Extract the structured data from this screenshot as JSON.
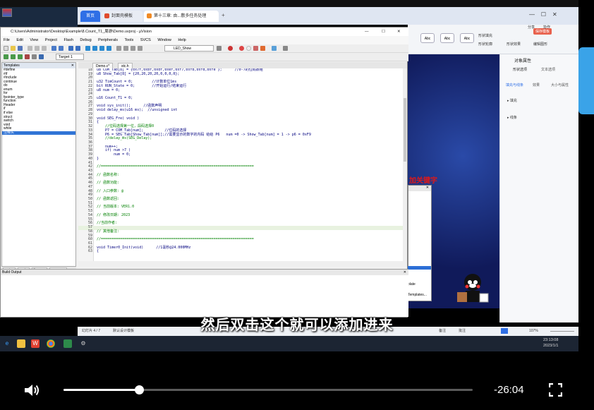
{
  "browser": {
    "tabs": [
      {
        "label": "首页"
      },
      {
        "label": "封面壳模板"
      },
      {
        "label": "第十三章: 由...敷多任务处理"
      }
    ]
  },
  "uvision": {
    "title": "C:\\Users\\Administrator\\Desktop\\Example\\8.Count_T1_周游\\Demo.uvproj - µVision",
    "menu": [
      "File",
      "Edit",
      "View",
      "Project",
      "Flash",
      "Debug",
      "Peripherals",
      "Tools",
      "SVCS",
      "Window",
      "Help"
    ],
    "toolbar_target": "LED_Show",
    "target_label": "Target 1",
    "templates_title": "Templates",
    "templates": [
      "#define",
      "#if",
      "#include",
      "continue",
      "do",
      "enum",
      "for",
      "fpointer_type",
      "function",
      "Header",
      "if",
      "if else",
      "struct",
      "switch",
      "void",
      "while",
      "注释头"
    ],
    "templates_selected": "注释头",
    "panel_tabs": [
      "Project",
      "Books",
      "{} Func...",
      "0+ Temp..."
    ],
    "editor_tabs": [
      "Demo.c*",
      "stc.h"
    ],
    "build_output_title": "Build Output",
    "code": [
      {
        "n": "18",
        "t": "u8 COM_Tab[8] = {0x7f,0xbf,0xdf,0xef,0xf7,0xfb,0xfd,0xfe };      //0-7的位码数组"
      },
      {
        "n": "19",
        "t": "u8 Show_Tab[8] = {20,20,20,20,0,0,0,0};"
      },
      {
        "n": "20",
        "t": ""
      },
      {
        "n": "21",
        "t": "u32 TimCount = 0;         //计数单位1ms"
      },
      {
        "n": "22",
        "t": "bit RUN_State = 0;        //开始运行/结束运行"
      },
      {
        "n": "23",
        "t": "u8 num = 0;"
      },
      {
        "n": "24",
        "t": ""
      },
      {
        "n": "25",
        "t": "u16 Count_T1 = 0;"
      },
      {
        "n": "26",
        "t": ""
      },
      {
        "n": "27",
        "t": "void sys_init();      //函数声明"
      },
      {
        "n": "28",
        "t": "void delay_ms(u16 ms);  //unsigned int"
      },
      {
        "n": "29",
        "t": ""
      },
      {
        "n": "30",
        "t": "void SEG_Fre( void )"
      },
      {
        "n": "31",
        "t": "{"
      },
      {
        "n": "32",
        "t": "    //位码选择第一位，段码选择0"
      },
      {
        "n": "33",
        "t": "    P7 = COM_Tab[num];          //位码的选择"
      },
      {
        "n": "34",
        "t": "    P6 = SEG_Tab[Show_Tab[num]];//需要显示的数字的内码 给给 P6   num =0 -> Show_Tab[num] = 1 -> p6 = 0xF9"
      },
      {
        "n": "35",
        "t": "    //delay_ms(SEG_Delay);"
      },
      {
        "n": "36",
        "t": ""
      },
      {
        "n": "37",
        "t": "    num++;"
      },
      {
        "n": "38",
        "t": "    if( num >7 )"
      },
      {
        "n": "39",
        "t": "        num = 0;"
      },
      {
        "n": "40",
        "t": "}"
      },
      {
        "n": "41",
        "t": ""
      },
      {
        "n": "42",
        "t": "//========================================================================"
      },
      {
        "n": "43",
        "t": ""
      },
      {
        "n": "44",
        "t": "// 函数名称:"
      },
      {
        "n": "45",
        "t": ""
      },
      {
        "n": "46",
        "t": "// 函数功能:"
      },
      {
        "n": "47",
        "t": ""
      },
      {
        "n": "48",
        "t": "// 入口参数: @"
      },
      {
        "n": "49",
        "t": ""
      },
      {
        "n": "50",
        "t": "// 函数返回:"
      },
      {
        "n": "51",
        "t": ""
      },
      {
        "n": "52",
        "t": "// 当前版本: VER1.0"
      },
      {
        "n": "53",
        "t": ""
      },
      {
        "n": "54",
        "t": "// 修改日期: 2023"
      },
      {
        "n": "55",
        "t": ""
      },
      {
        "n": "56",
        "t": "//当前作者:"
      },
      {
        "n": "57",
        "t": ""
      },
      {
        "n": "58",
        "t": "// 其他备注:"
      },
      {
        "n": "59",
        "t": ""
      },
      {
        "n": "60",
        "t": "//========================================================================"
      },
      {
        "n": "61",
        "t": ""
      },
      {
        "n": "62",
        "t": "void Timer0_Init(void)      //1毫秒@24.000MHz"
      },
      {
        "n": "63",
        "t": "{"
      }
    ]
  },
  "ppt": {
    "toolbar_items": [
      "形状填充",
      "形状轮廓",
      "形状效果",
      "编辑图形",
      "设计",
      "保存模板",
      "创意"
    ],
    "panel_title": "对象属性",
    "panel_tabs": [
      "形状选项",
      "文本选项"
    ],
    "panel_subtabs": [
      "填充与线条",
      "效果",
      "大小与属性"
    ],
    "panel_rows": [
      "填充",
      "线条"
    ],
    "share": "分享",
    "collab": "协作",
    "keyword_text": "加关键字",
    "dialog_late": "plate",
    "dialog_templates": "Templates...",
    "status_left": "幻灯片 4 / 7",
    "status_design": "默认设计模板",
    "status_notes": "备注",
    "status_comments": "批注",
    "zoom": "107%"
  },
  "subtitle": "然后双击这个就可以添加进来",
  "taskbar": {
    "time": "23:13:08",
    "date": "2023/1/1"
  },
  "player": {
    "remaining": "-26:04",
    "progress_fraction": 0.185
  }
}
